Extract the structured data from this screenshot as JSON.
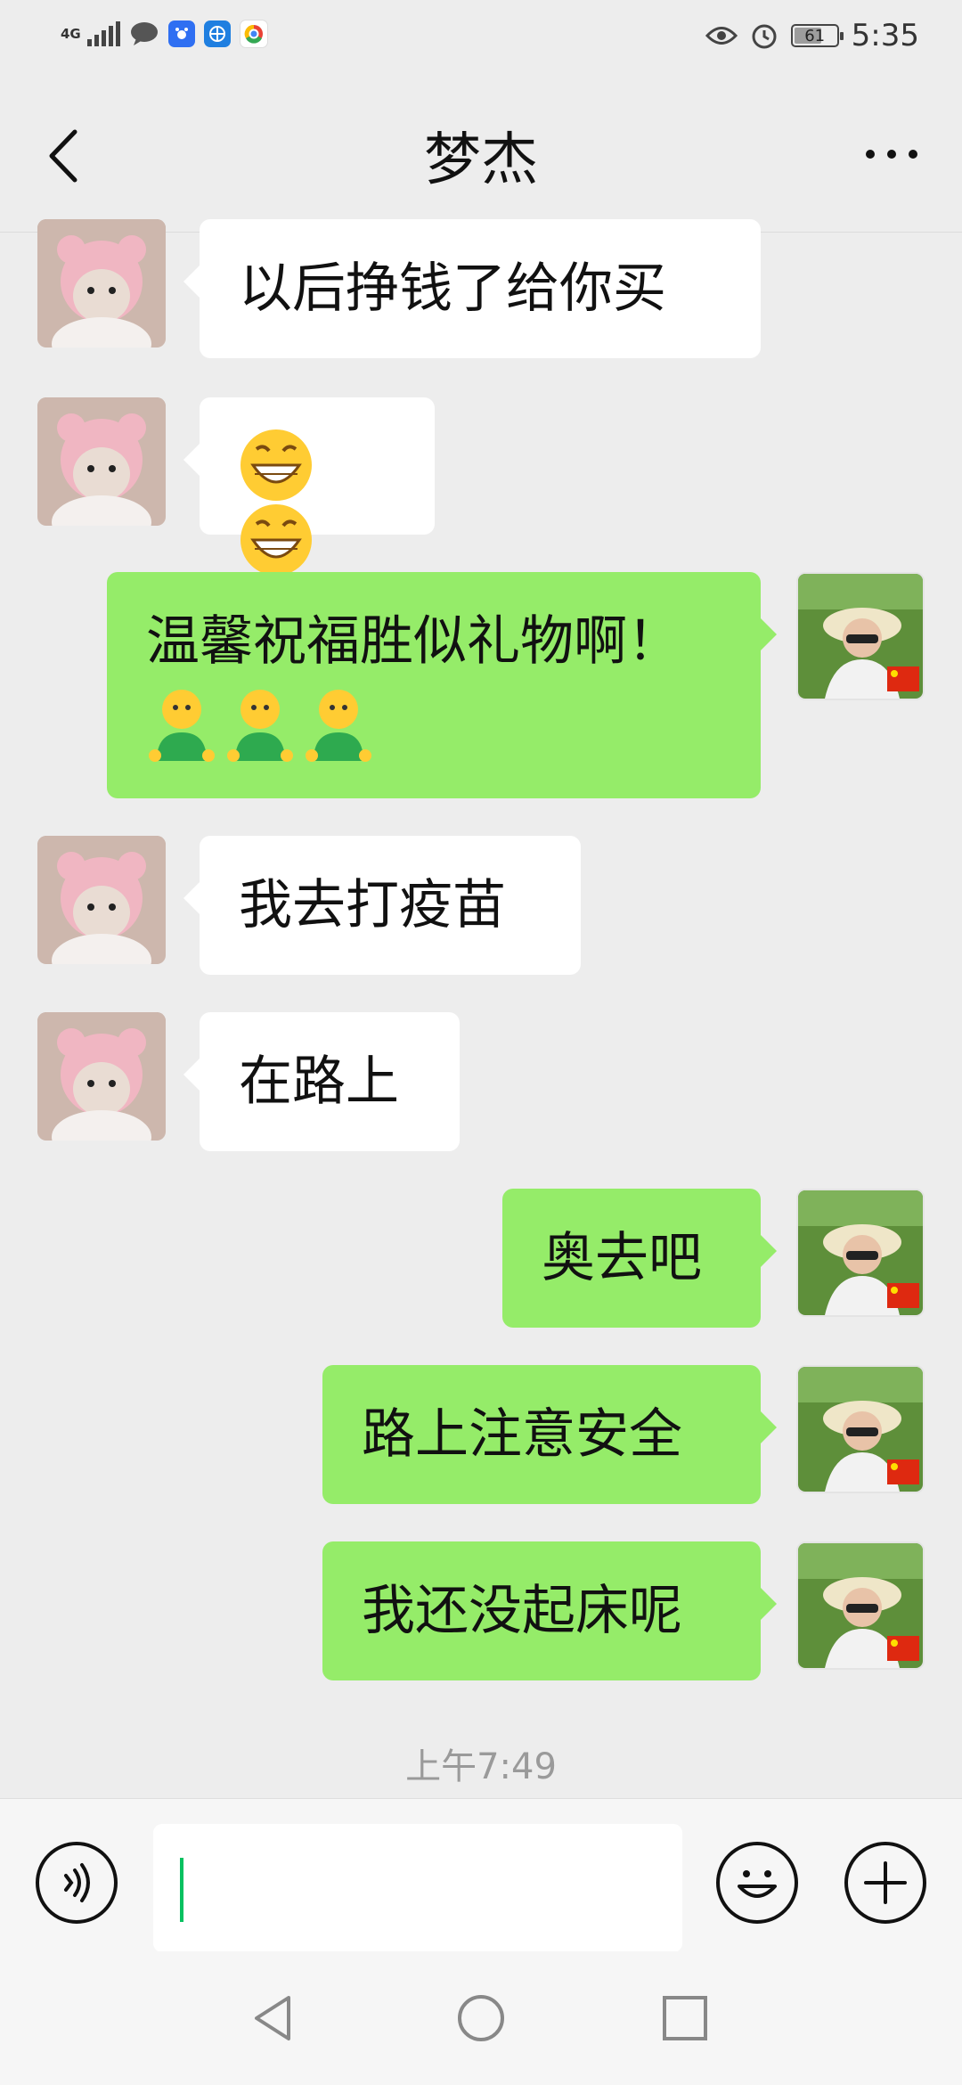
{
  "status_bar": {
    "network": "4G",
    "battery": "61",
    "time": "5:35"
  },
  "header": {
    "title": "梦杰"
  },
  "messages": [
    {
      "side": "in",
      "text": "以后挣钱了给你买"
    },
    {
      "side": "in",
      "emoji": [
        "grinning-face-emoji",
        "grinning-face-emoji"
      ]
    },
    {
      "side": "out",
      "text": "温馨祝福胜似礼物啊！",
      "emoji": [
        "person-emoji",
        "person-emoji",
        "person-emoji"
      ]
    },
    {
      "side": "in",
      "text": "我去打疫苗"
    },
    {
      "side": "in",
      "text": "在路上"
    },
    {
      "side": "out",
      "text": "奥去吧"
    },
    {
      "side": "out",
      "text": "路上注意安全"
    },
    {
      "side": "out",
      "text": "我还没起床呢"
    }
  ],
  "timestamp": "上午7:49",
  "input": {
    "value": "",
    "voice_icon": "voice-icon",
    "emoji_icon": "emoji-icon",
    "plus_icon": "plus-icon"
  },
  "nav": [
    "back-triangle-icon",
    "home-circle-icon",
    "recents-square-icon"
  ],
  "colors": {
    "background": "#ededed",
    "incoming_bubble": "#ffffff",
    "outgoing_bubble": "#95ec69",
    "caret": "#07c160",
    "timestamp": "#9a9a9a"
  }
}
